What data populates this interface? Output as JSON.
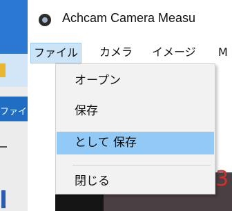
{
  "window": {
    "title": "Achcam Camera Measu"
  },
  "background_window": {
    "label": "ファイ"
  },
  "menubar": {
    "items": [
      {
        "label": "ファイル",
        "active": true
      },
      {
        "label": "カメラ",
        "active": false
      },
      {
        "label": "イメージ",
        "active": false
      },
      {
        "label": "M",
        "active": false
      }
    ]
  },
  "file_menu": {
    "items": [
      {
        "label": "オープン",
        "highlighted": false
      },
      {
        "label": "保存",
        "highlighted": false
      },
      {
        "label": "として 保存",
        "highlighted": true
      },
      {
        "label": "閉じる",
        "highlighted": false
      }
    ]
  },
  "client": {
    "partial_glyph": "3"
  },
  "colors": {
    "menu_active_bg": "#cce4f7",
    "menu_item_highlight": "#91c9f7",
    "dropdown_bg": "#f2f2f2",
    "accent_blue": "#2a78d2",
    "red_text": "#d0312d"
  },
  "icons": {
    "app": "camera-app-icon"
  }
}
